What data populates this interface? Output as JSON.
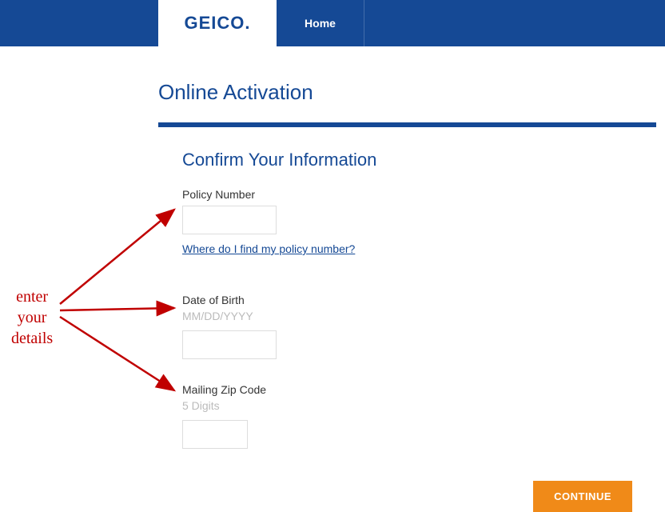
{
  "header": {
    "logo": "GEICO.",
    "home_label": "Home"
  },
  "page_title": "Online Activation",
  "card": {
    "title": "Confirm Your Information",
    "policy": {
      "label": "Policy Number",
      "help_link": "Where do I find my policy number?",
      "value": ""
    },
    "dob": {
      "label": "Date of Birth",
      "hint": "MM/DD/YYYY",
      "value": ""
    },
    "zip": {
      "label": "Mailing Zip Code",
      "hint": "5 Digits",
      "value": ""
    },
    "continue_label": "CONTINUE"
  },
  "annotation": {
    "line1": "enter",
    "line2": "your",
    "line3": "details"
  },
  "colors": {
    "brand": "#154995",
    "accent": "#f08a18",
    "annotation": "#c00000"
  }
}
